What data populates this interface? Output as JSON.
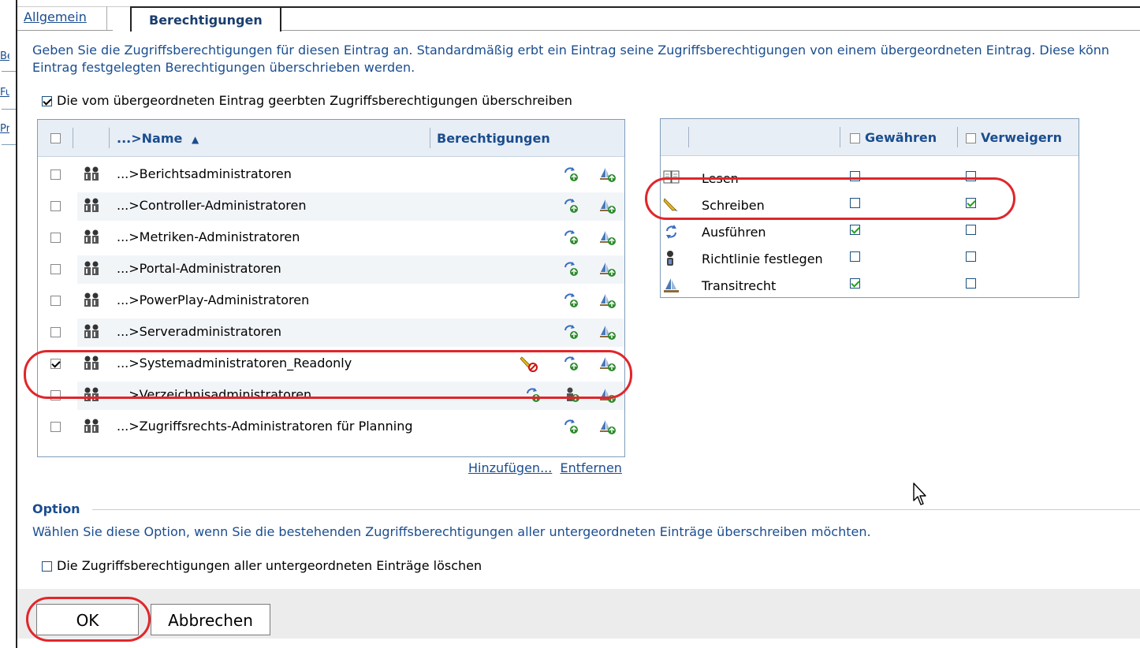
{
  "sidebar": {
    "link_1": "Be",
    "link_2": "Fu",
    "link_3": "Pr"
  },
  "tabs": {
    "general": "Allgemein",
    "permissions": "Berechtigungen"
  },
  "description": {
    "line1": "Geben Sie die Zugriffsberechtigungen für diesen Eintrag an. Standardmäßig erbt ein Eintrag seine Zugriffsberechtigungen von einem übergeordneten Eintrag. Diese könn",
    "line2": "Eintrag festgelegten Berechtigungen überschrieben werden."
  },
  "override_label": "Die vom übergeordneten Eintrag geerbten Zugriffsberechtigungen überschreiben",
  "members": {
    "header_name": "...>Name",
    "sort_indicator": "▲",
    "header_permissions": "Berechtigungen",
    "rows": [
      {
        "name": "...>Berichtsadministratoren",
        "checked": false
      },
      {
        "name": "...>Controller-Administratoren",
        "checked": false
      },
      {
        "name": "...>Metriken-Administratoren",
        "checked": false
      },
      {
        "name": "...>Portal-Administratoren",
        "checked": false
      },
      {
        "name": "...>PowerPlay-Administratoren",
        "checked": false
      },
      {
        "name": "...>Serveradministratoren",
        "checked": false
      },
      {
        "name": "...>Systemadministratoren_Readonly",
        "checked": true
      },
      {
        "name": "...>Verzeichnisadministratoren",
        "checked": false
      },
      {
        "name": "...>Zugriffsrechts-Administratoren für Planning",
        "checked": false
      }
    ]
  },
  "links": {
    "add": "Hinzufügen...",
    "remove": "Entfernen"
  },
  "permissions": {
    "header_grant": "Gewähren",
    "header_deny": "Verweigern",
    "rows": [
      {
        "name": "Lesen",
        "icon": "book-icon",
        "grant": false,
        "deny": false
      },
      {
        "name": "Schreiben",
        "icon": "pencil-icon",
        "grant": false,
        "deny": true
      },
      {
        "name": "Ausführen",
        "icon": "execute-icon",
        "grant": true,
        "deny": false
      },
      {
        "name": "Richtlinie festlegen",
        "icon": "policy-icon",
        "grant": false,
        "deny": false
      },
      {
        "name": "Transitrecht",
        "icon": "traverse-icon",
        "grant": true,
        "deny": false
      }
    ]
  },
  "option": {
    "title": "Option",
    "description": "Wählen Sie diese Option, wenn Sie die bestehenden Zugriffsberechtigungen aller untergeordneten Einträge überschreiben möchten.",
    "checkbox_label": "Die Zugriffsberechtigungen aller untergeordneten Einträge löschen"
  },
  "buttons": {
    "ok": "OK",
    "cancel": "Abbrechen"
  },
  "colors": {
    "link": "#1a4d8f",
    "header_bg": "#e8eef5",
    "annotation": "#e0262b",
    "check_green": "#21a121"
  }
}
